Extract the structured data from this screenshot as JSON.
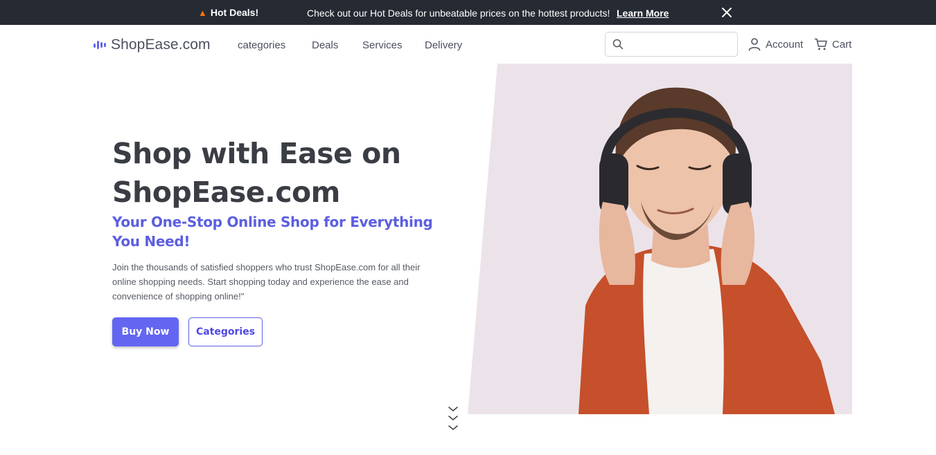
{
  "banner": {
    "flame_icon": "flame-icon",
    "hot_label": "Hot Deals!",
    "message": "Check out our Hot Deals for unbeatable prices on the hottest products!",
    "learn_more": "Learn More"
  },
  "nav": {
    "logo_text": "ShopEase.com",
    "links": [
      "categories",
      "Deals",
      "Services",
      "Delivery"
    ],
    "search_placeholder": "",
    "account": "Account",
    "cart": "Cart"
  },
  "hero": {
    "title": "Shop with Ease on ShopEase.com",
    "subtitle": "Your One-Stop Online Shop for Everything You Need!",
    "description": "Join the thousands of satisfied shoppers who trust ShopEase.com for all their online shopping needs. Start shopping today and experience the ease and convenience of shopping online!\"",
    "buy_now": "Buy Now",
    "categories": "Categories"
  },
  "colors": {
    "banner_bg": "#252a33",
    "accent": "#6366f1",
    "title": "#3a3d44",
    "image_bg": "#ece3ea",
    "shirt": "#c5502b"
  }
}
